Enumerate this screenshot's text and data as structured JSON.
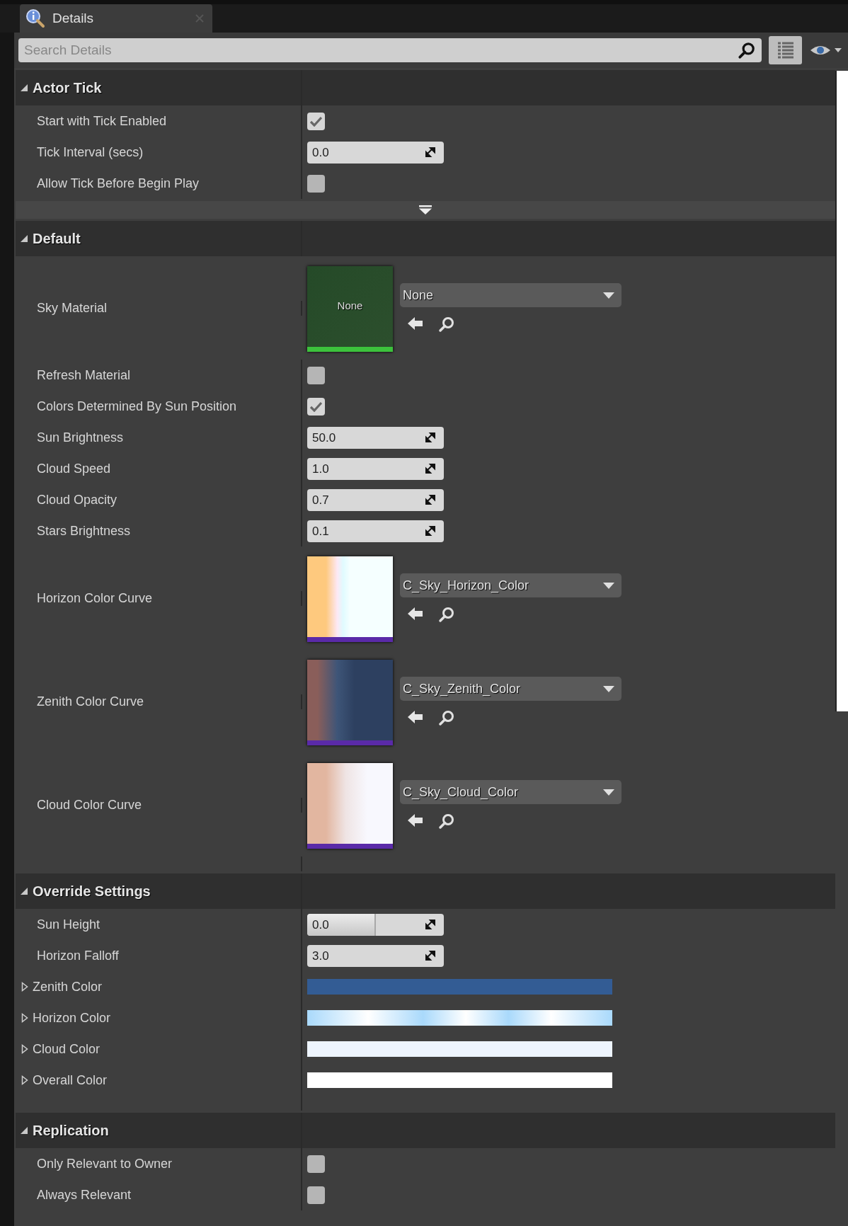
{
  "tab": {
    "title": "Details",
    "selected": true
  },
  "search": {
    "placeholder": "Search Details"
  },
  "sections": [
    {
      "title": "Actor Tick",
      "expanded": true,
      "advanced_bar": true,
      "rows": [
        {
          "kind": "checkbox",
          "label": "Start with Tick Enabled",
          "checked": true
        },
        {
          "kind": "number",
          "label": "Tick Interval (secs)",
          "value": "0.0"
        },
        {
          "kind": "checkbox",
          "label": "Allow Tick Before Begin Play",
          "checked": false
        }
      ]
    },
    {
      "title": "Default",
      "expanded": true,
      "rows": [
        {
          "kind": "material",
          "label": "Sky Material",
          "value": "None",
          "thumbnail_text": "None"
        },
        {
          "kind": "checkbox",
          "label": "Refresh Material",
          "checked": false
        },
        {
          "kind": "checkbox",
          "label": "Colors Determined By Sun Position",
          "checked": true
        },
        {
          "kind": "number",
          "label": "Sun Brightness",
          "value": "50.0"
        },
        {
          "kind": "number",
          "label": "Cloud Speed",
          "value": "1.0"
        },
        {
          "kind": "number",
          "label": "Cloud Opacity",
          "value": "0.7"
        },
        {
          "kind": "number",
          "label": "Stars Brightness",
          "value": "0.1"
        },
        {
          "kind": "curve",
          "label": "Horizon Color Curve",
          "value": "C_Sky_Horizon_Color"
        },
        {
          "kind": "curve",
          "label": "Zenith Color Curve",
          "value": "C_Sky_Zenith_Color"
        },
        {
          "kind": "curve",
          "label": "Cloud Color Curve",
          "value": "C_Sky_Cloud_Color"
        }
      ]
    },
    {
      "title": "Override Settings",
      "expanded": true,
      "rows": [
        {
          "kind": "number",
          "label": "Sun Height",
          "value": "0.0",
          "level": 0.5
        },
        {
          "kind": "number",
          "label": "Horizon Falloff",
          "value": "3.0"
        },
        {
          "kind": "color",
          "label": "Zenith Color",
          "expanded": false,
          "color": "#335c94"
        },
        {
          "kind": "color",
          "label": "Horizon Color",
          "expanded": false,
          "color": "#a9d9fb"
        },
        {
          "kind": "color",
          "label": "Cloud Color",
          "expanded": false,
          "color": "#eef5fe"
        },
        {
          "kind": "color",
          "label": "Overall Color",
          "expanded": false,
          "color": "#ffffff"
        }
      ]
    },
    {
      "title": "Replication",
      "expanded": true,
      "rows": [
        {
          "kind": "checkbox",
          "label": "Only Relevant to Owner",
          "checked": false
        },
        {
          "kind": "checkbox",
          "label": "Always Relevant",
          "checked": false
        }
      ]
    }
  ]
}
